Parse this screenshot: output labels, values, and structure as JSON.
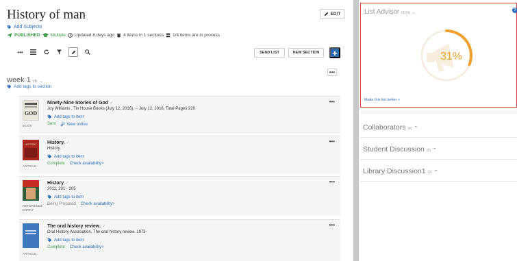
{
  "list": {
    "title": "History of man",
    "edit_label": "EDIT",
    "add_subjects": "Add Subjects",
    "published": "PUBLISHED",
    "multiple": "Multiple",
    "updated": "Updated 6 days ago",
    "items_info": "4 items in 1 sections",
    "process_info": "1/4 items are in process"
  },
  "toolbar": {
    "send_list": "SEND LIST",
    "new_section": "NEW SECTION",
    "add_label": "+",
    "icons": [
      "more-icon",
      "list-view-icon",
      "refresh-icon",
      "filter-icon",
      "edit-pencil-icon",
      "search-icon"
    ]
  },
  "section": {
    "title": "week 1",
    "count": "(4)",
    "add_tags": "Add tags to section",
    "menu": "•••"
  },
  "items": [
    {
      "title": "Ninety-Nine Stories of God",
      "detail": "Joy Williams , Tin House Books (July 12, 2016), -- July 12, 2016, Total Pages 220",
      "add_tags": "Add tags to item",
      "status": "Sent",
      "status_color": "green",
      "action": "View online",
      "kind": "BOOK",
      "thumb_text": "GOD"
    },
    {
      "title": "History.",
      "detail": "History.",
      "add_tags": "Add tags to item",
      "status": "Complete",
      "status_color": "green",
      "action": "Check availability>",
      "kind": "ARTICLE",
      "thumb_text": "HISTORY"
    },
    {
      "title": "History",
      "detail": "2011, 201 - 205",
      "add_tags": "Add tags to item",
      "status": "Being Prepared",
      "status_color": "gray",
      "action": "Check availability>",
      "kind": "REFERENCE ENTRY",
      "thumb_text": ""
    },
    {
      "title": "The oral history review.",
      "detail": "Oral History Association. The oral history review. 1973-",
      "add_tags": "Add tags to item",
      "status": "Complete",
      "status_color": "green",
      "action": "Check availability>",
      "kind": "ARTICLE",
      "thumb_text": ""
    }
  ],
  "advisor": {
    "title": "List Advisor",
    "pct_small": "(31%)",
    "score": "31%",
    "score_value": 31,
    "link": "Make this list better >",
    "help": "?"
  },
  "side_sections": [
    {
      "label": "Collaborators",
      "count": "(4)"
    },
    {
      "label": "Student Discussion",
      "count": "(0)"
    },
    {
      "label": "Library Discussion1",
      "count": "(0)"
    }
  ],
  "colors": {
    "accent_blue": "#2c6bb2",
    "green": "#3b9b47",
    "gauge_orange": "#f0a030",
    "highlight_red": "#d9423a"
  }
}
